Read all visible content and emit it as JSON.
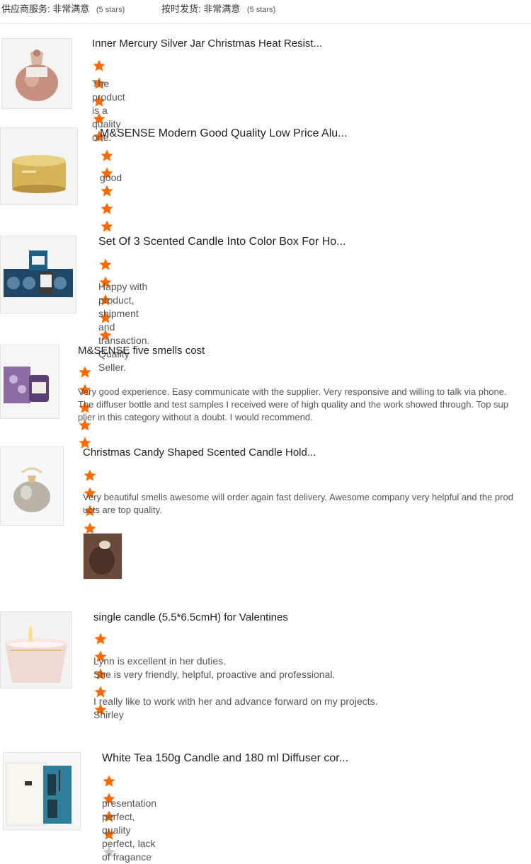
{
  "header": {
    "supplier_service_label": "供应商服务:",
    "supplier_service_value": "非常满意",
    "supplier_service_stars": "(5 stars)",
    "delivery_label": "按时发货:",
    "delivery_value": "非常满意",
    "delivery_stars": "(5 stars)"
  },
  "reviews": [
    {
      "title": "Inner Mercury Silver Jar Christmas Heat Resist...",
      "rating": 5,
      "text": "The product is a quality one."
    },
    {
      "title": "M&SENSE Modern Good Quality Low Price Alu...",
      "rating": 5,
      "text": "good"
    },
    {
      "title": "Set Of 3 Scented Candle Into Color Box For Ho...",
      "rating": 5,
      "text": "Happy with product, shipment and transaction. Quality Seller."
    },
    {
      "title": "M&SENSE five smells cost",
      "rating": 5,
      "text_lines": [
        "Very good experience.  Easy communicate with the supplier.  Very responsive and willing to talk via phone.",
        "The diffuser bottle and test samples I received were of high quality and the work showed through.  Top sup",
        "plier in this category without a doubt.  I would recommend."
      ]
    },
    {
      "title": "Christmas Candy Shaped Scented Candle Hold...",
      "rating": 5,
      "text_lines": [
        "Very beautiful smells awesome will order again fast delivery. Awesome company very helpful and the prod",
        "ucts are top quality."
      ]
    },
    {
      "title": "single candle (5.5*6.5cmH) for Valentines",
      "rating": 5,
      "text_lines": [
        "Lynn is excellent in her duties.",
        "She is very friendly, helpful, proactive and professional.",
        "",
        "I really like to work with her and advance forward on my projects.",
        "Shirley"
      ]
    },
    {
      "title": "White Tea 150g Candle and 180 ml Diffuser cor...",
      "rating": 4,
      "text": "presentation perfect, quality perfect, lack of fragance"
    }
  ],
  "colors": {
    "star_filled": "#ff6a00",
    "star_empty": "#c8c8d0"
  }
}
